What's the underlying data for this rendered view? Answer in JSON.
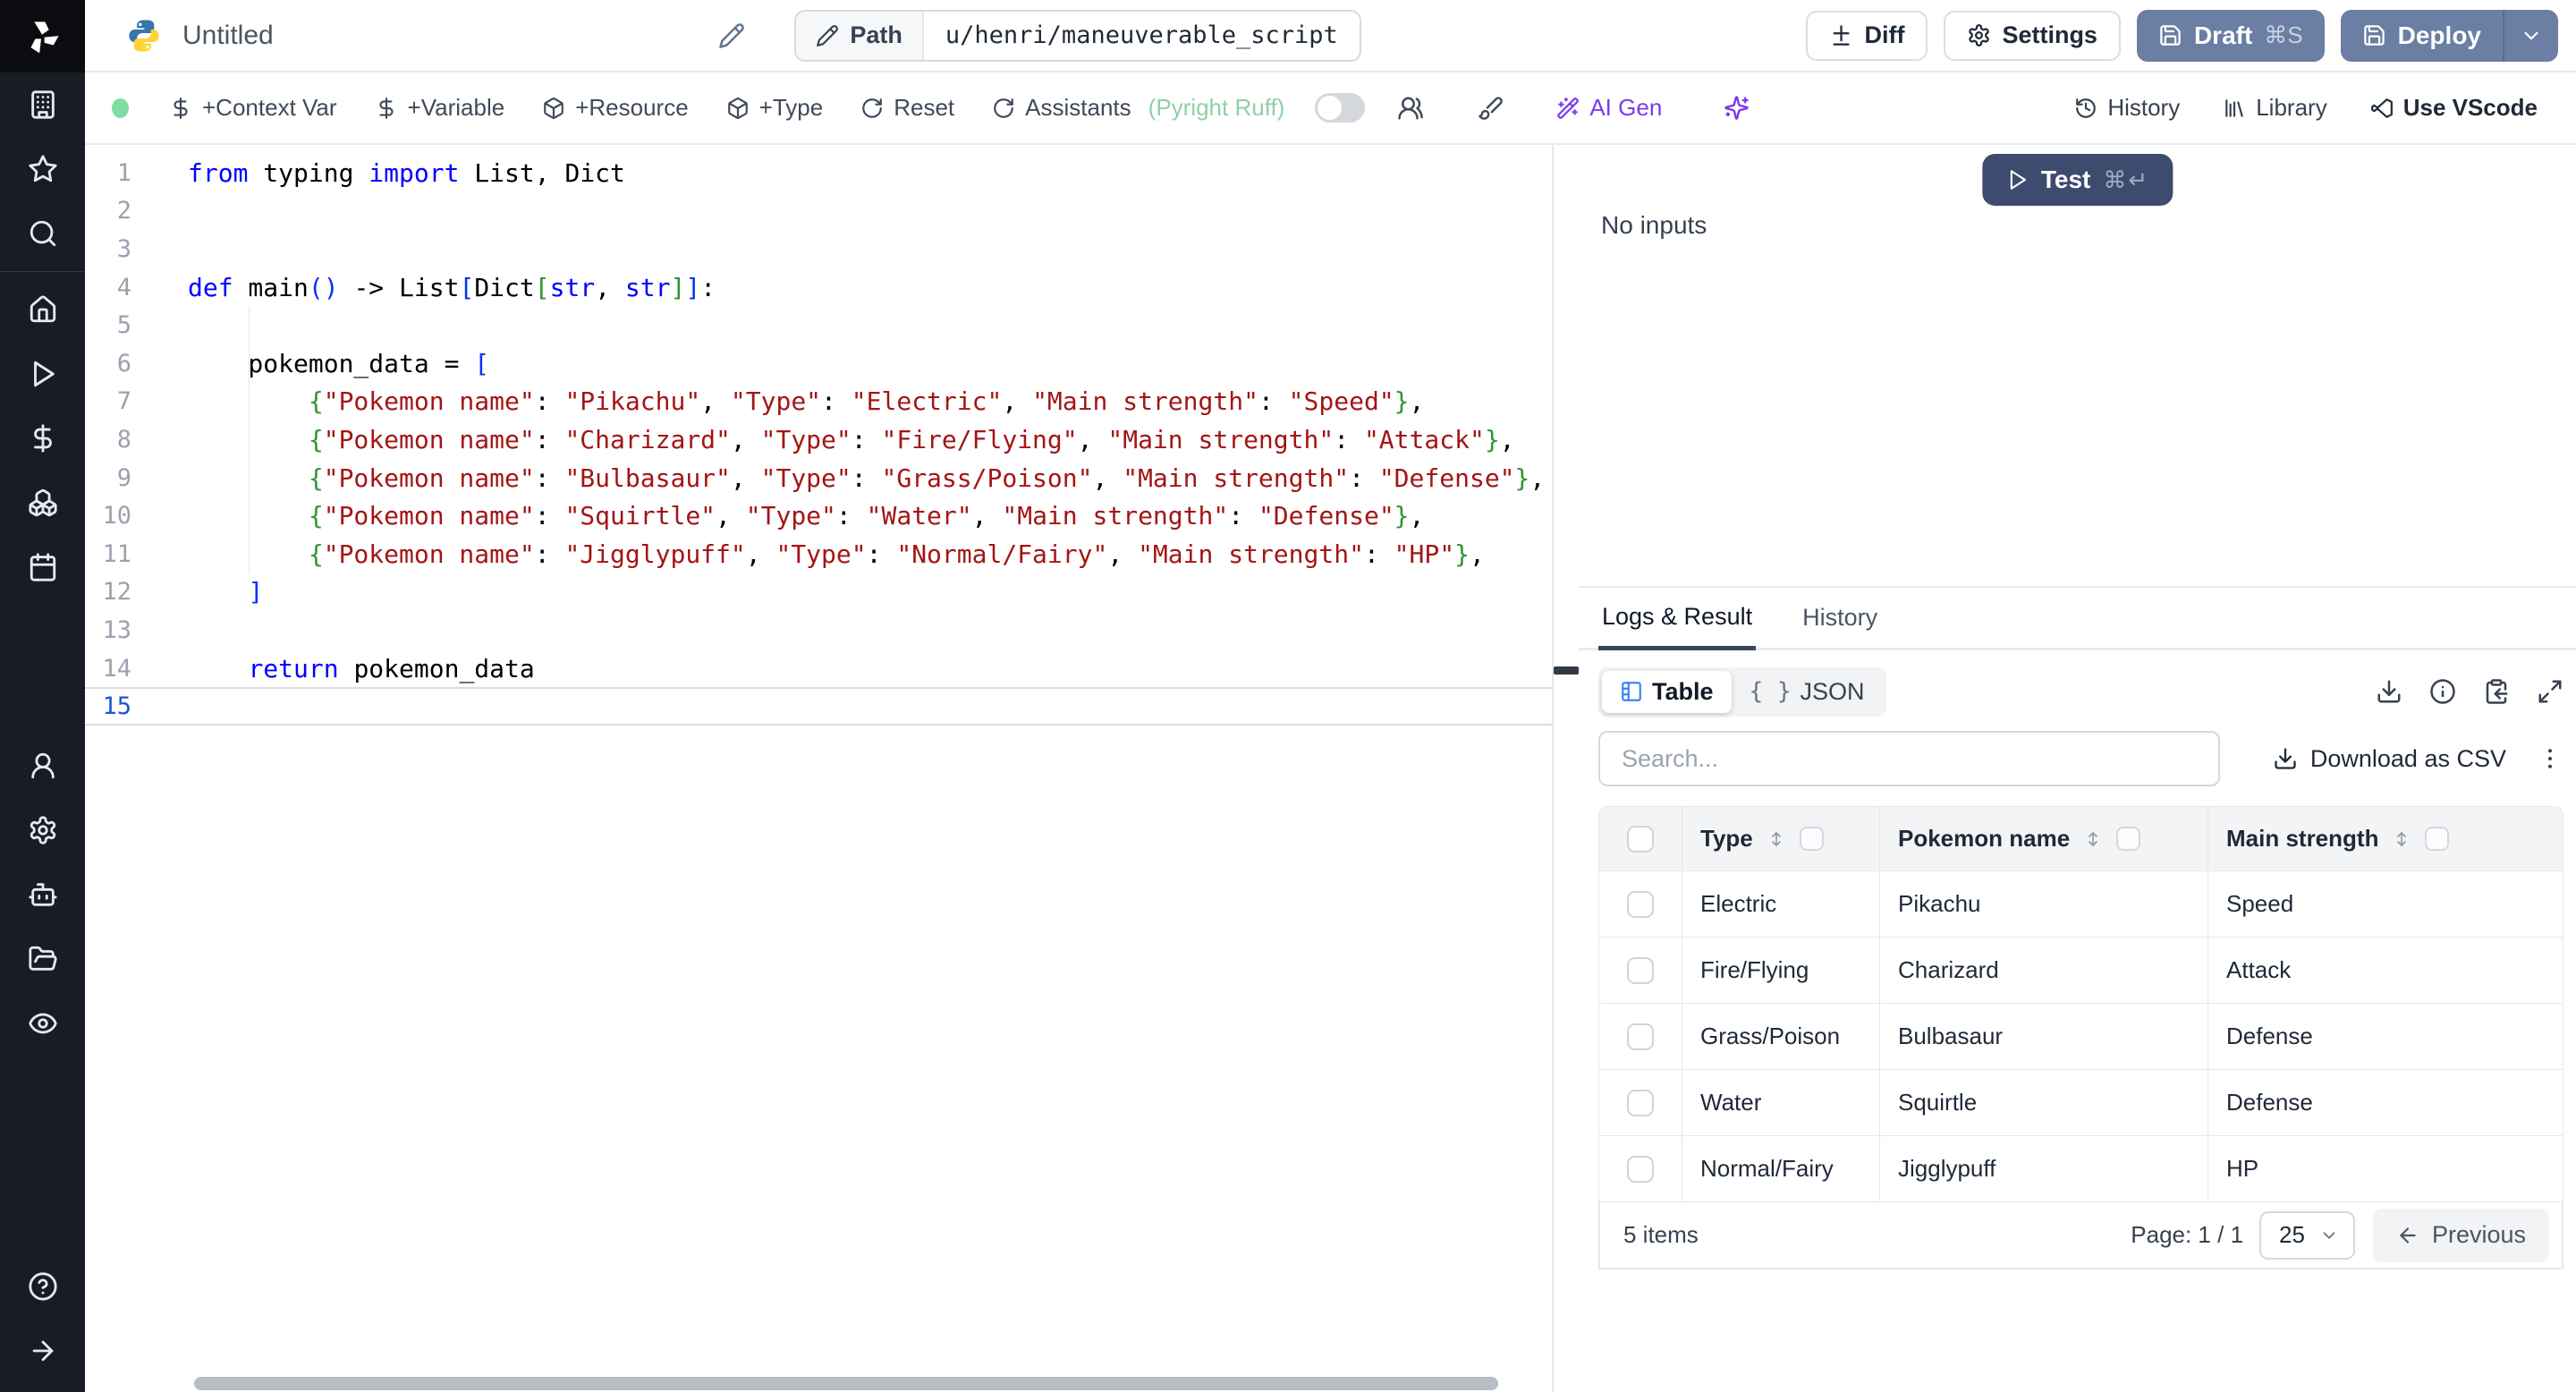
{
  "topbar": {
    "title": "Untitled",
    "path_label": "Path",
    "path_value": "u/henri/maneuverable_script",
    "diff_label": "Diff",
    "settings_label": "Settings",
    "draft_label": "Draft",
    "draft_shortcut": "⌘S",
    "deploy_label": "Deploy"
  },
  "toolbar": {
    "context_var": "+Context Var",
    "variable": "+Variable",
    "resource": "+Resource",
    "type": "+Type",
    "reset": "Reset",
    "assistants": "Assistants",
    "assistants_detail": "(Pyright Ruff)",
    "ai_gen": "AI Gen",
    "history": "History",
    "library": "Library",
    "vscode": "Use VScode"
  },
  "editor": {
    "language": "python",
    "current_line": 15,
    "lines": [
      {
        "n": 1,
        "tokens": [
          [
            "kw",
            "from"
          ],
          [
            "tx",
            " typing "
          ],
          [
            "kw",
            "import"
          ],
          [
            "tx",
            " List, Dict"
          ]
        ]
      },
      {
        "n": 2,
        "tokens": []
      },
      {
        "n": 3,
        "tokens": []
      },
      {
        "n": 4,
        "tokens": [
          [
            "kw",
            "def"
          ],
          [
            "tx",
            " main"
          ],
          [
            "b1",
            "()"
          ],
          [
            "tx",
            " -> List"
          ],
          [
            "b1",
            "["
          ],
          [
            "tx",
            "Dict"
          ],
          [
            "b2",
            "["
          ],
          [
            "kw",
            "str"
          ],
          [
            "tx",
            ", "
          ],
          [
            "kw",
            "str"
          ],
          [
            "b2",
            "]"
          ],
          [
            "b1",
            "]"
          ],
          [
            "tx",
            ":"
          ]
        ]
      },
      {
        "n": 5,
        "tokens": []
      },
      {
        "n": 6,
        "tokens": [
          [
            "tx",
            "    pokemon_data = "
          ],
          [
            "b1",
            "["
          ]
        ]
      },
      {
        "n": 7,
        "tokens": [
          [
            "tx",
            "        "
          ],
          [
            "b2",
            "{"
          ],
          [
            "st",
            "\"Pokemon name\""
          ],
          [
            "tx",
            ": "
          ],
          [
            "st",
            "\"Pikachu\""
          ],
          [
            "tx",
            ", "
          ],
          [
            "st",
            "\"Type\""
          ],
          [
            "tx",
            ": "
          ],
          [
            "st",
            "\"Electric\""
          ],
          [
            "tx",
            ", "
          ],
          [
            "st",
            "\"Main strength\""
          ],
          [
            "tx",
            ": "
          ],
          [
            "st",
            "\"Speed\""
          ],
          [
            "b2",
            "}"
          ],
          [
            "tx",
            ","
          ]
        ]
      },
      {
        "n": 8,
        "tokens": [
          [
            "tx",
            "        "
          ],
          [
            "b2",
            "{"
          ],
          [
            "st",
            "\"Pokemon name\""
          ],
          [
            "tx",
            ": "
          ],
          [
            "st",
            "\"Charizard\""
          ],
          [
            "tx",
            ", "
          ],
          [
            "st",
            "\"Type\""
          ],
          [
            "tx",
            ": "
          ],
          [
            "st",
            "\"Fire/Flying\""
          ],
          [
            "tx",
            ", "
          ],
          [
            "st",
            "\"Main strength\""
          ],
          [
            "tx",
            ": "
          ],
          [
            "st",
            "\"Attack\""
          ],
          [
            "b2",
            "}"
          ],
          [
            "tx",
            ","
          ]
        ]
      },
      {
        "n": 9,
        "tokens": [
          [
            "tx",
            "        "
          ],
          [
            "b2",
            "{"
          ],
          [
            "st",
            "\"Pokemon name\""
          ],
          [
            "tx",
            ": "
          ],
          [
            "st",
            "\"Bulbasaur\""
          ],
          [
            "tx",
            ", "
          ],
          [
            "st",
            "\"Type\""
          ],
          [
            "tx",
            ": "
          ],
          [
            "st",
            "\"Grass/Poison\""
          ],
          [
            "tx",
            ", "
          ],
          [
            "st",
            "\"Main strength\""
          ],
          [
            "tx",
            ": "
          ],
          [
            "st",
            "\"Defense\""
          ],
          [
            "b2",
            "}"
          ],
          [
            "tx",
            ","
          ]
        ]
      },
      {
        "n": 10,
        "tokens": [
          [
            "tx",
            "        "
          ],
          [
            "b2",
            "{"
          ],
          [
            "st",
            "\"Pokemon name\""
          ],
          [
            "tx",
            ": "
          ],
          [
            "st",
            "\"Squirtle\""
          ],
          [
            "tx",
            ", "
          ],
          [
            "st",
            "\"Type\""
          ],
          [
            "tx",
            ": "
          ],
          [
            "st",
            "\"Water\""
          ],
          [
            "tx",
            ", "
          ],
          [
            "st",
            "\"Main strength\""
          ],
          [
            "tx",
            ": "
          ],
          [
            "st",
            "\"Defense\""
          ],
          [
            "b2",
            "}"
          ],
          [
            "tx",
            ","
          ]
        ]
      },
      {
        "n": 11,
        "tokens": [
          [
            "tx",
            "        "
          ],
          [
            "b2",
            "{"
          ],
          [
            "st",
            "\"Pokemon name\""
          ],
          [
            "tx",
            ": "
          ],
          [
            "st",
            "\"Jigglypuff\""
          ],
          [
            "tx",
            ", "
          ],
          [
            "st",
            "\"Type\""
          ],
          [
            "tx",
            ": "
          ],
          [
            "st",
            "\"Normal/Fairy\""
          ],
          [
            "tx",
            ", "
          ],
          [
            "st",
            "\"Main strength\""
          ],
          [
            "tx",
            ": "
          ],
          [
            "st",
            "\"HP\""
          ],
          [
            "b2",
            "}"
          ],
          [
            "tx",
            ","
          ]
        ]
      },
      {
        "n": 12,
        "tokens": [
          [
            "tx",
            "    "
          ],
          [
            "b1",
            "]"
          ]
        ]
      },
      {
        "n": 13,
        "tokens": []
      },
      {
        "n": 14,
        "tokens": [
          [
            "tx",
            "    "
          ],
          [
            "kw",
            "return"
          ],
          [
            "tx",
            " pokemon_data"
          ]
        ]
      },
      {
        "n": 15,
        "tokens": []
      }
    ]
  },
  "run_panel": {
    "test_label": "Test",
    "test_shortcut": "⌘↵",
    "no_inputs": "No inputs"
  },
  "result_panel": {
    "tabs": [
      "Logs & Result",
      "History"
    ],
    "active_tab": "Logs & Result",
    "view_table": "Table",
    "view_json": "JSON",
    "json_glyph": "{ }",
    "search_placeholder": "Search...",
    "download_csv": "Download as CSV",
    "table": {
      "columns": [
        "Type",
        "Pokemon name",
        "Main strength"
      ],
      "rows": [
        {
          "type": "Electric",
          "name": "Pikachu",
          "strength": "Speed"
        },
        {
          "type": "Fire/Flying",
          "name": "Charizard",
          "strength": "Attack"
        },
        {
          "type": "Grass/Poison",
          "name": "Bulbasaur",
          "strength": "Defense"
        },
        {
          "type": "Water",
          "name": "Squirtle",
          "strength": "Defense"
        },
        {
          "type": "Normal/Fairy",
          "name": "Jigglypuff",
          "strength": "HP"
        }
      ]
    },
    "footer": {
      "items_label": "5 items",
      "page_label": "Page: 1 / 1",
      "page_size": "25",
      "previous_label": "Previous"
    }
  },
  "sidebar_icons": [
    "windmill-logo",
    "building",
    "star",
    "search",
    "home",
    "play",
    "dollar-sign",
    "boxes",
    "calendar",
    "user",
    "settings",
    "bot",
    "folder-open",
    "eye",
    "help-circle",
    "arrow-right"
  ],
  "colors": {
    "accent_blue": "#3b82f6",
    "purple": "#7c3aed",
    "slate_button": "#6b7ea3",
    "test_button": "#3c4b6e",
    "status_green": "#7fdda4",
    "pyright_green": "#8fd0a5",
    "string_red": "#a31515",
    "keyword_blue": "#0000ff",
    "bracket_blue": "#0431fa",
    "bracket_green": "#319331",
    "sidebar_bg": "#191c24"
  }
}
